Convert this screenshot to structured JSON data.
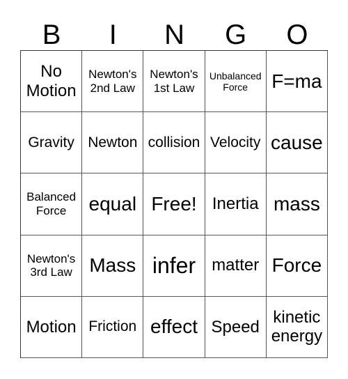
{
  "header": [
    "B",
    "I",
    "N",
    "G",
    "O"
  ],
  "cells": [
    [
      "No Motion",
      "Newton's 2nd Law",
      "Newton's 1st Law",
      "Unbalanced Force",
      "F=ma"
    ],
    [
      "Gravity",
      "Newton",
      "collision",
      "Velocity",
      "cause"
    ],
    [
      "Balanced Force",
      "equal",
      "Free!",
      "Inertia",
      "mass"
    ],
    [
      "Newton's 3rd Law",
      "Mass",
      "infer",
      "matter",
      "Force"
    ],
    [
      "Motion",
      "Friction",
      "effect",
      "Speed",
      "kinetic energy"
    ]
  ]
}
